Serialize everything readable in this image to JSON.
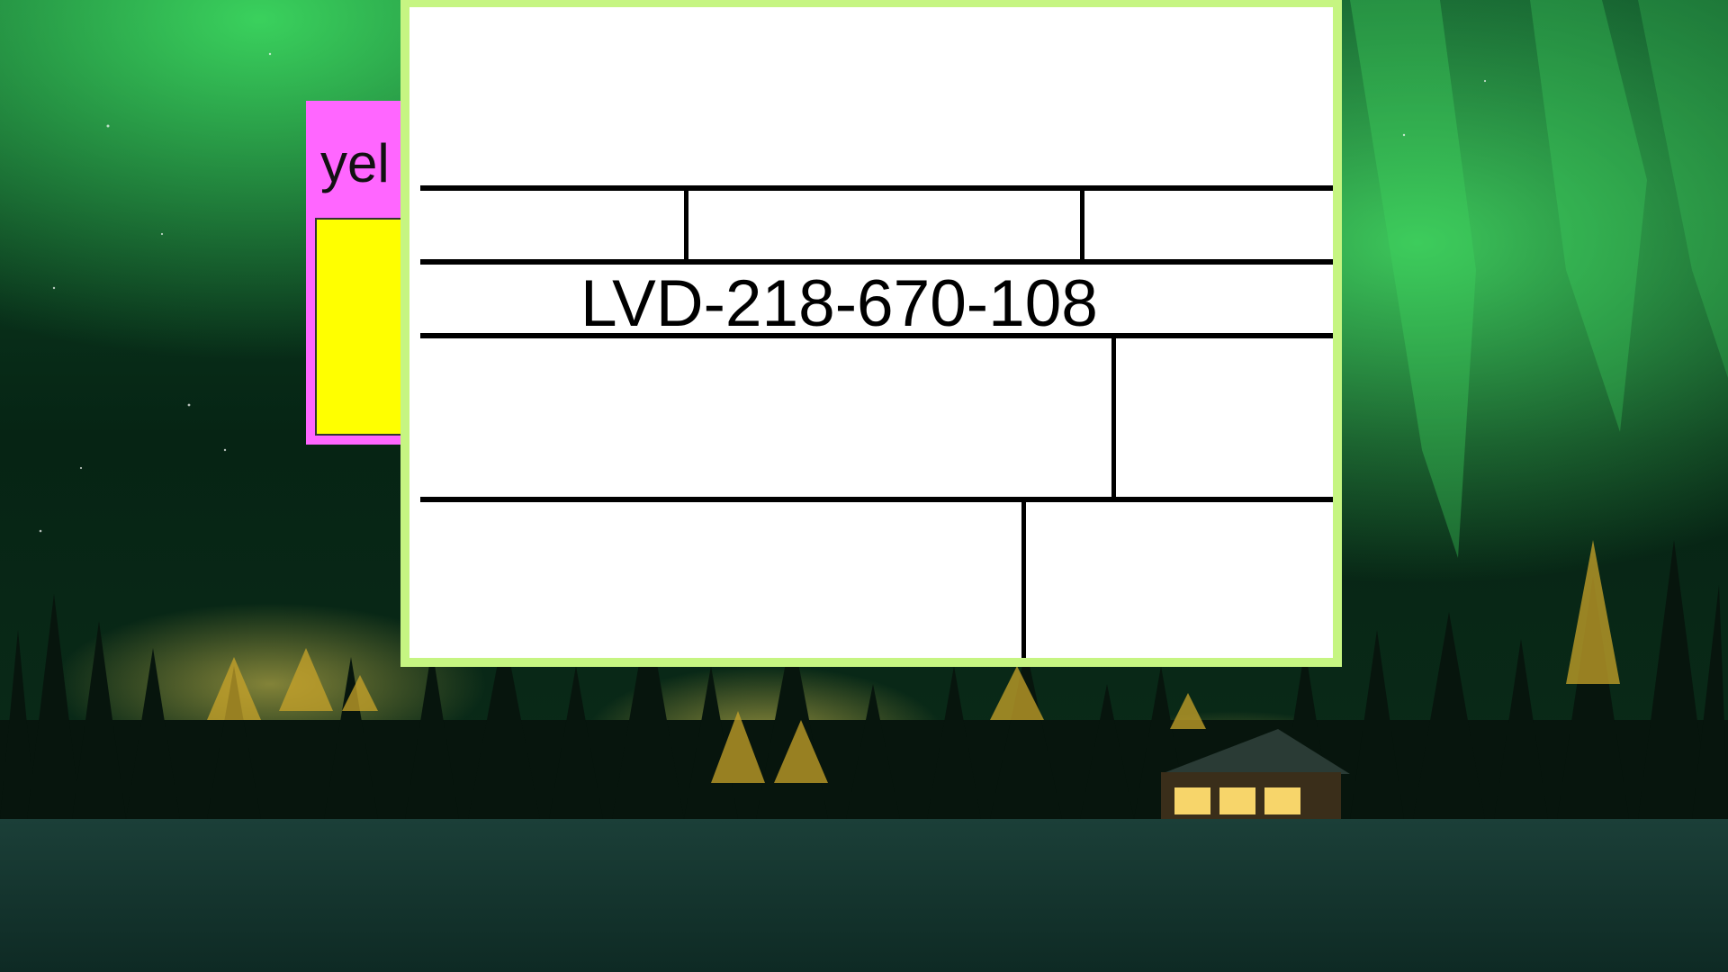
{
  "background": {
    "scene": "aurora-night-forest",
    "colors": {
      "sky_top": "#0b3a1e",
      "sky_dark": "#05140c",
      "aurora": "#39d45a",
      "snow": "#123a30",
      "lights": "#f2d24a"
    }
  },
  "behind_widget": {
    "label": "yel",
    "colors": {
      "frame": "#ff66ff",
      "fill": "#ffff00"
    }
  },
  "panel": {
    "code": "LVD-218-670-108",
    "colors": {
      "border": "#c6f582",
      "fill": "#ffffff",
      "lines": "#000000"
    }
  }
}
